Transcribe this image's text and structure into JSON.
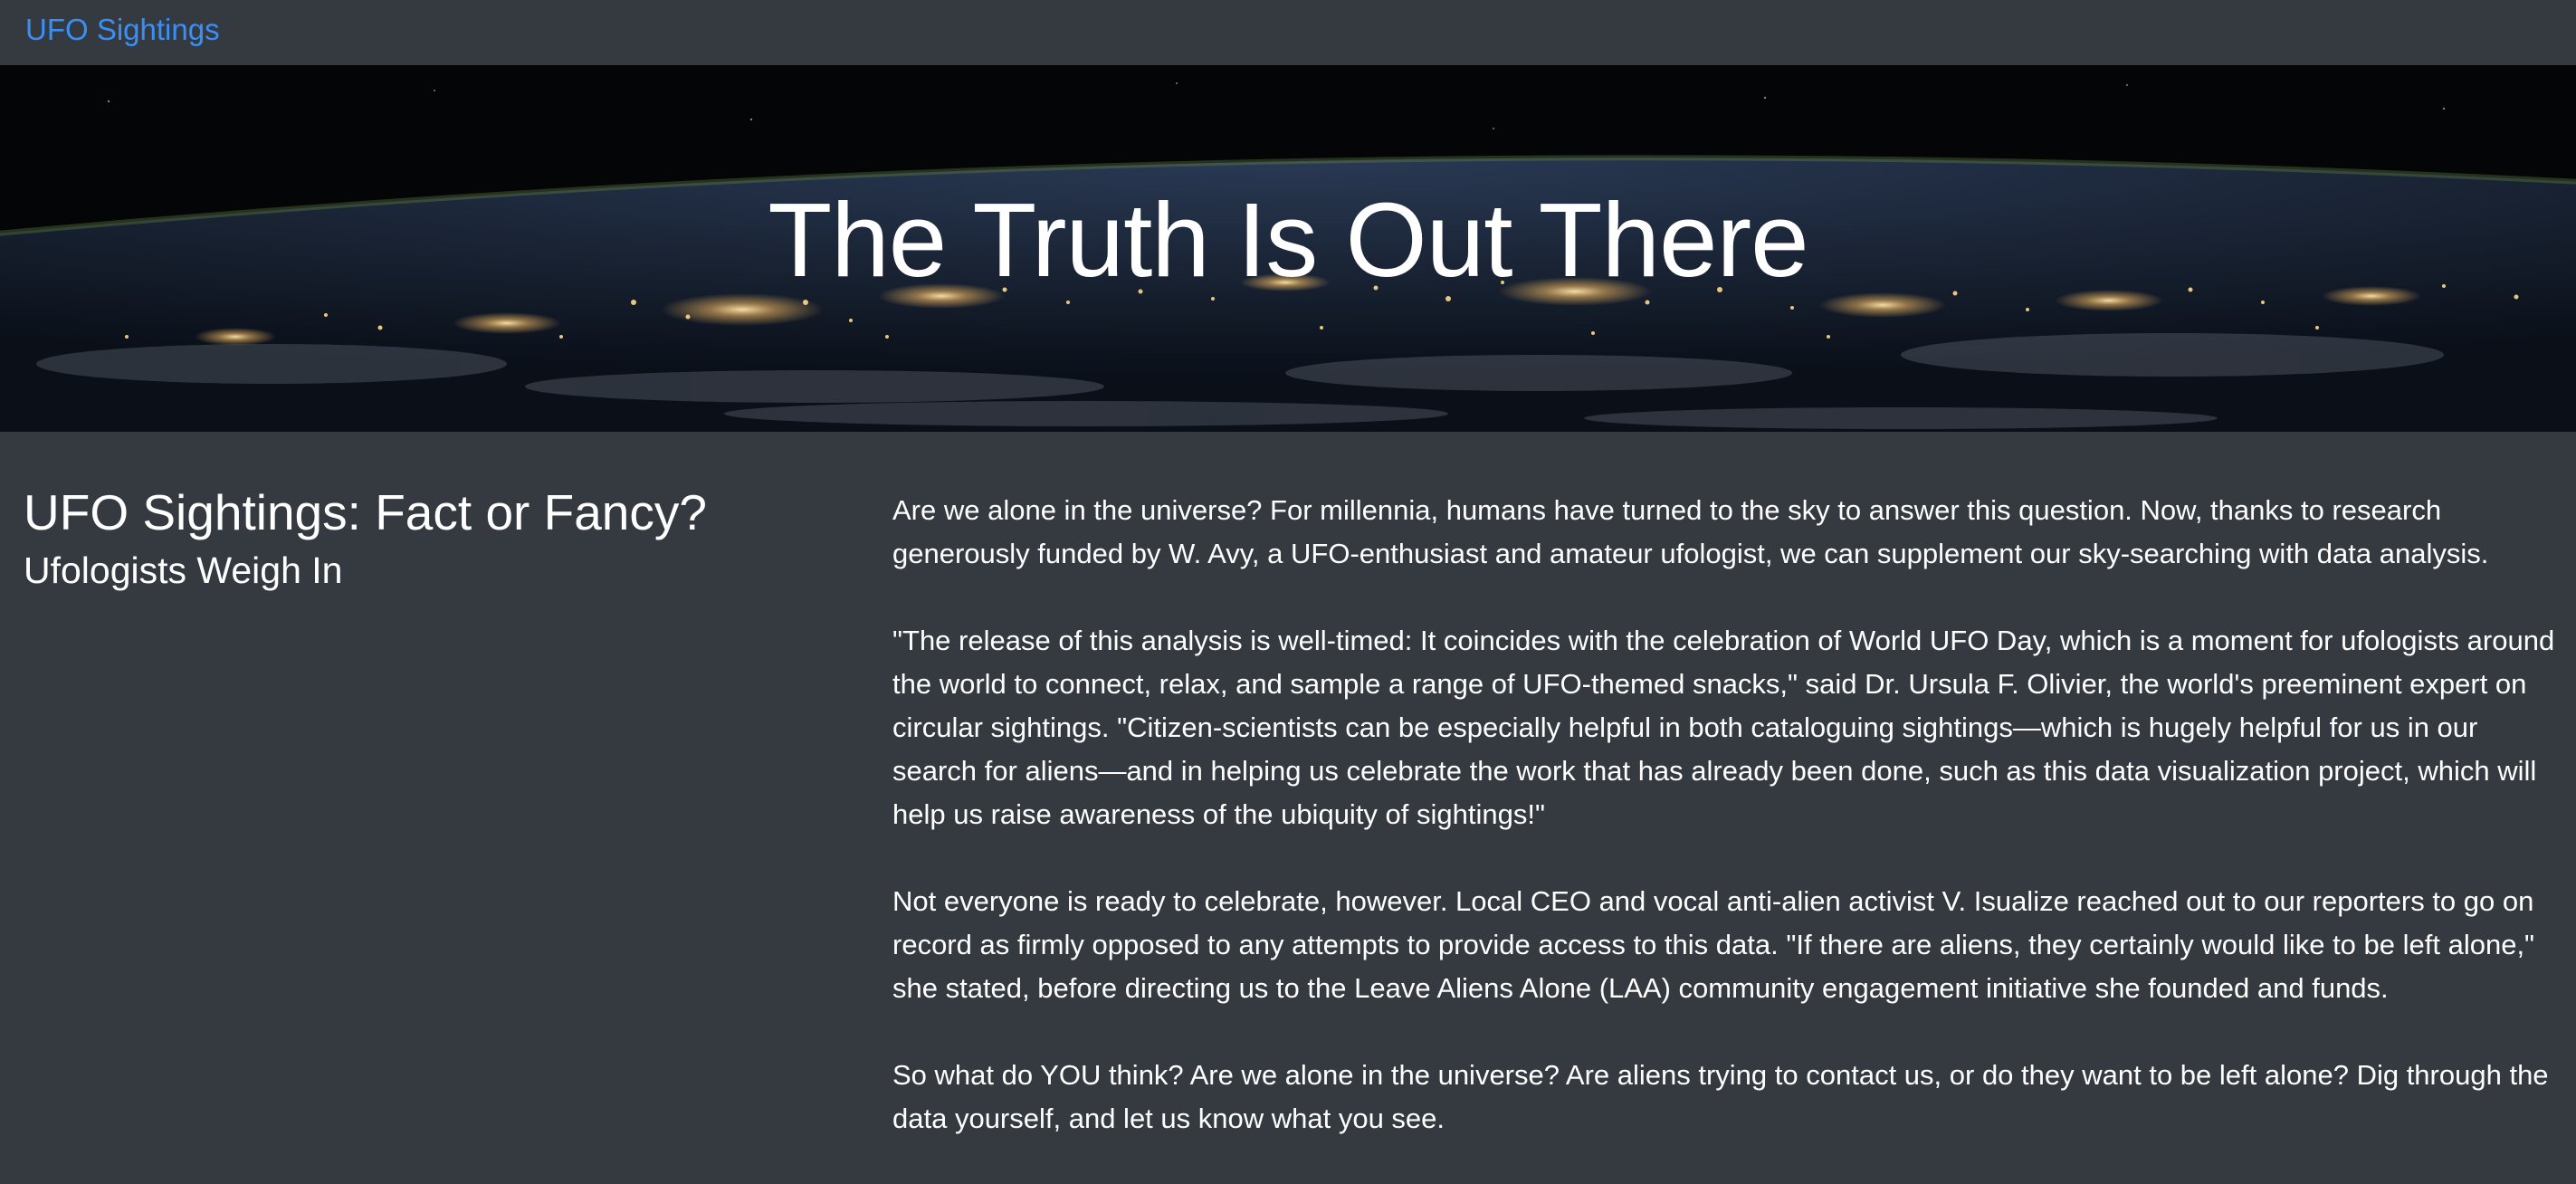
{
  "navbar": {
    "brand": "UFO Sightings"
  },
  "hero": {
    "title": "The Truth Is Out There"
  },
  "article": {
    "headline": "UFO Sightings: Fact or Fancy?",
    "subheadline": "Ufologists Weigh In",
    "paragraphs": [
      "Are we alone in the universe? For millennia, humans have turned to the sky to answer this question. Now, thanks to research generously funded by W. Avy, a UFO-enthusiast and amateur ufologist, we can supplement our sky-searching with data analysis.",
      "\"The release of this analysis is well-timed: It coincides with the celebration of World UFO Day, which is a moment for ufologists around the world to connect, relax, and sample a range of UFO-themed snacks,\" said Dr. Ursula F. Olivier, the world's preeminent expert on circular sightings. \"Citizen-scientists can be especially helpful in both cataloguing sightings—which is hugely helpful for us in our search for aliens—and in helping us celebrate the work that has already been done, such as this data visualization project, which will help us raise awareness of the ubiquity of sightings!\"",
      "Not everyone is ready to celebrate, however. Local CEO and vocal anti-alien activist V. Isualize reached out to our reporters to go on record as firmly opposed to any attempts to provide access to this data. \"If there are aliens, they certainly would like to be left alone,\" she stated, before directing us to the Leave Aliens Alone (LAA) community engagement initiative she founded and funds.",
      "So what do YOU think? Are we alone in the universe? Are aliens trying to contact us, or do they want to be left alone? Dig through the data yourself, and let us know what you see."
    ]
  },
  "colors": {
    "background": "#343a40",
    "brand_link": "#3a8ff7",
    "text": "#ffffff"
  }
}
